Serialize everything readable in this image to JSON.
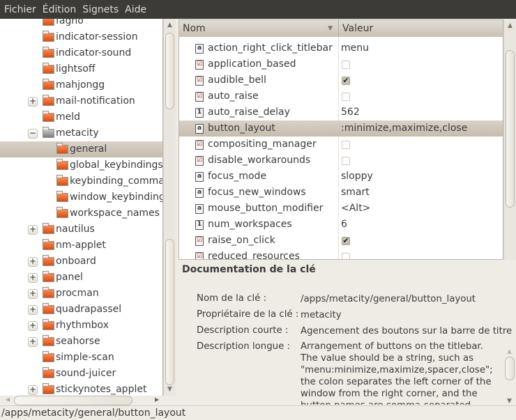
{
  "menubar": [
    "Fichier",
    "Édition",
    "Signets",
    "Aide"
  ],
  "tree": [
    {
      "label": "fagno",
      "level": 0,
      "expander": ""
    },
    {
      "label": "indicator-session",
      "level": 0,
      "expander": ""
    },
    {
      "label": "indicator-sound",
      "level": 0,
      "expander": ""
    },
    {
      "label": "lightsoff",
      "level": 0,
      "expander": ""
    },
    {
      "label": "mahjongg",
      "level": 0,
      "expander": ""
    },
    {
      "label": "mail-notification",
      "level": 0,
      "expander": "+"
    },
    {
      "label": "meld",
      "level": 0,
      "expander": ""
    },
    {
      "label": "metacity",
      "level": 0,
      "expander": "−",
      "open": true
    },
    {
      "label": "general",
      "level": 1,
      "expander": "",
      "selected": true
    },
    {
      "label": "global_keybindings",
      "level": 1,
      "expander": ""
    },
    {
      "label": "keybinding_commands",
      "level": 1,
      "expander": ""
    },
    {
      "label": "window_keybindings",
      "level": 1,
      "expander": ""
    },
    {
      "label": "workspace_names",
      "level": 1,
      "expander": ""
    },
    {
      "label": "nautilus",
      "level": 0,
      "expander": "+"
    },
    {
      "label": "nm-applet",
      "level": 0,
      "expander": ""
    },
    {
      "label": "onboard",
      "level": 0,
      "expander": "+"
    },
    {
      "label": "panel",
      "level": 0,
      "expander": "+"
    },
    {
      "label": "procman",
      "level": 0,
      "expander": "+"
    },
    {
      "label": "quadrapassel",
      "level": 0,
      "expander": "+"
    },
    {
      "label": "rhythmbox",
      "level": 0,
      "expander": "+"
    },
    {
      "label": "seahorse",
      "level": 0,
      "expander": "+"
    },
    {
      "label": "simple-scan",
      "level": 0,
      "expander": ""
    },
    {
      "label": "sound-juicer",
      "level": 0,
      "expander": ""
    },
    {
      "label": "stickynotes_applet",
      "level": 0,
      "expander": "+"
    }
  ],
  "table": {
    "col_name": "Nom",
    "col_value": "Valeur",
    "rows": [
      {
        "name": "action_right_click_titlebar",
        "type": "string",
        "value": "menu"
      },
      {
        "name": "application_based",
        "type": "bool",
        "checked": false
      },
      {
        "name": "audible_bell",
        "type": "bool",
        "checked": true
      },
      {
        "name": "auto_raise",
        "type": "bool",
        "checked": false
      },
      {
        "name": "auto_raise_delay",
        "type": "int",
        "value": "562"
      },
      {
        "name": "button_layout",
        "type": "string",
        "value": ":minimize,maximize,close",
        "selected": true
      },
      {
        "name": "compositing_manager",
        "type": "bool",
        "checked": false
      },
      {
        "name": "disable_workarounds",
        "type": "bool",
        "checked": false
      },
      {
        "name": "focus_mode",
        "type": "string",
        "value": "sloppy"
      },
      {
        "name": "focus_new_windows",
        "type": "string",
        "value": "smart"
      },
      {
        "name": "mouse_button_modifier",
        "type": "string",
        "value": "<Alt>"
      },
      {
        "name": "num_workspaces",
        "type": "int",
        "value": "6"
      },
      {
        "name": "raise_on_click",
        "type": "bool",
        "checked": true
      },
      {
        "name": "reduced_resources",
        "type": "bool",
        "checked": false
      }
    ]
  },
  "doc": {
    "title": "Documentation de la clé",
    "key_name_label": "Nom de la clé :",
    "key_name": "/apps/metacity/general/button_layout",
    "owner_label": "Propriétaire de la clé :",
    "owner": "metacity",
    "short_label": "Description courte :",
    "short": "Agencement des boutons sur la barre de titre",
    "long_label": "Description longue :",
    "long": "Arrangement of buttons on the titlebar. The value should be a string, such as \"menu:minimize,maximize,spacer,close\"; the colon separates the left corner of the window from the right corner, and the button names are comma-separated."
  },
  "status": "/apps/metacity/general/button_layout"
}
